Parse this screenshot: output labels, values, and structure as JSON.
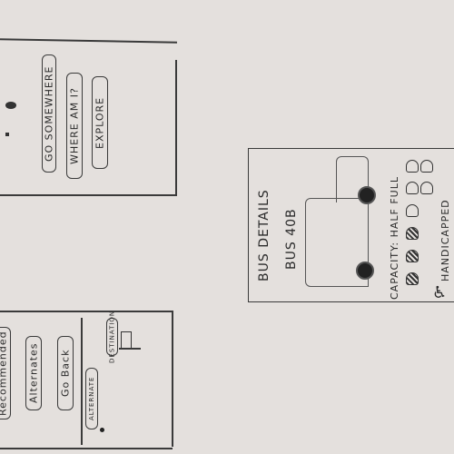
{
  "home_screen": {
    "buttons": [
      {
        "label": "GO SOMEWHERE"
      },
      {
        "label": "WHERE AM I?"
      },
      {
        "label": "EXPLORE"
      }
    ]
  },
  "route_screen": {
    "buttons": [
      {
        "label": "Recommended"
      },
      {
        "label": "Alternates"
      },
      {
        "label": "Go Back"
      }
    ],
    "map": {
      "destination_label": "DESTINATION",
      "alternate_label": "ALTERNATE"
    }
  },
  "bus_details_screen": {
    "title": "BUS DETAILS",
    "bus_name": "BUS 40B",
    "capacity_label": "CAPACITY: HALF FULL",
    "capacity": {
      "filled": 3,
      "total": 8
    },
    "handicapped_label": "HANDICAPPED"
  }
}
